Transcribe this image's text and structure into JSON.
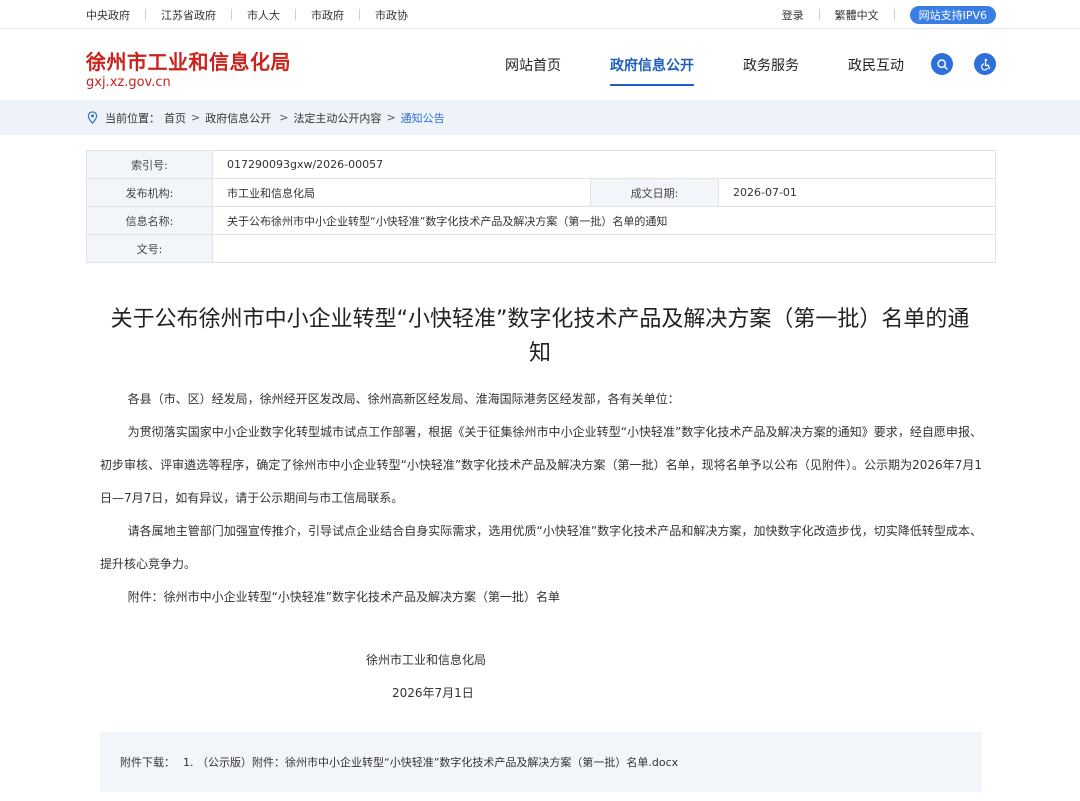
{
  "topbar": {
    "links": [
      "中央政府",
      "江苏省政府",
      "市人大",
      "市政府",
      "市政协"
    ],
    "login": "登录",
    "traditional": "繁體中文",
    "ipv6": "网站支持IPV6"
  },
  "header": {
    "title": "徐州市工业和信息化局",
    "domain": "gxj.xz.gov.cn",
    "nav": [
      "网站首页",
      "政府信息公开",
      "政务服务",
      "政民互动"
    ]
  },
  "breadcrumb": {
    "prefix": "当前位置：",
    "items": [
      "首页",
      "政府信息公开",
      "法定主动公开内容",
      "通知公告"
    ]
  },
  "info": {
    "index_label": "索引号:",
    "index_value": "017290093gxw/2026-00057",
    "org_label": "发布机构:",
    "org_value": "市工业和信息化局",
    "date_label": "成文日期:",
    "date_value": "2026-07-01",
    "name_label": "信息名称:",
    "name_value": "关于公布徐州市中小企业转型“小快轻准”数字化技术产品及解决方案（第一批）名单的通知",
    "doc_label": "文号:",
    "doc_value": ""
  },
  "article": {
    "title": "关于公布徐州市中小企业转型“小快轻准”数字化技术产品及解决方案（第一批）名单的通知",
    "paragraphs": [
      "各县（市、区）经发局，徐州经开区发改局、徐州高新区经发局、淮海国际港务区经发部，各有关单位：",
      "为贯彻落实国家中小企业数字化转型城市试点工作部署，根据《关于征集徐州市中小企业转型“小快轻准”数字化技术产品及解决方案的通知》要求，经自愿申报、初步审核、评审遴选等程序，确定了徐州市中小企业转型“小快轻准”数字化技术产品及解决方案（第一批）名单，现将名单予以公布（见附件）。公示期为2026年7月1日—7月7日，如有异议，请于公示期间与市工信局联系。",
      "请各属地主管部门加强宣传推介，引导试点企业结合自身实际需求，选用优质“小快轻准”数字化技术产品和解决方案，加快数字化改造步伐，切实降低转型成本、提升核心竞争力。",
      "附件：徐州市中小企业转型“小快轻准”数字化技术产品及解决方案（第一批）名单"
    ],
    "signature": "徐州市工业和信息化局",
    "sign_date": "2026年7月1日"
  },
  "attachment": {
    "label": "附件下载：",
    "file": "1. （公示版）附件：徐州市中小企业转型“小快轻准”数字化技术产品及解决方案（第一批）名单.docx"
  },
  "colors": {
    "brand_red": "#c8231c",
    "nav_blue": "#1f5fbf",
    "accent_blue": "#2e6fd8",
    "light_bg": "#eef3f9"
  },
  "icons": [
    "location-pin-icon",
    "search-icon",
    "accessibility-icon"
  ]
}
